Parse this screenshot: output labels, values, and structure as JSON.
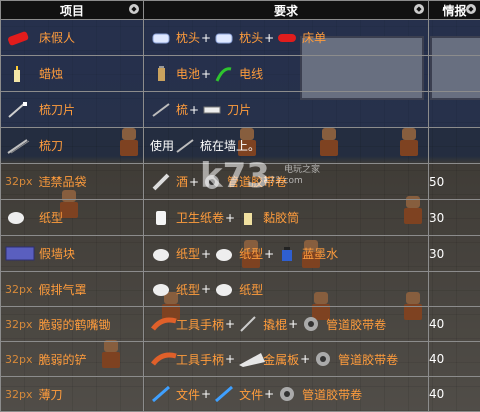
{
  "header": {
    "col_item": "项目",
    "col_req": "要求",
    "col_intel": "情报"
  },
  "rows": [
    {
      "px": "",
      "name": "床假人",
      "item_icon": "dummy-red-icon",
      "reqs": [
        {
          "icon": "pillow-icon",
          "name": "枕头",
          "plus": "+"
        },
        {
          "icon": "pillow-icon",
          "name": "枕头",
          "plus": "+"
        },
        {
          "icon": "bed-sheet-icon",
          "name": "床单",
          "plus": ""
        }
      ],
      "intel": ""
    },
    {
      "px": "",
      "name": "蜡烛",
      "item_icon": "candle-icon",
      "reqs": [
        {
          "icon": "battery-icon",
          "name": "电池",
          "plus": "+"
        },
        {
          "icon": "wire-icon",
          "name": "电线",
          "plus": ""
        }
      ],
      "intel": ""
    },
    {
      "px": "",
      "name": "梳刀片",
      "item_icon": "comb-blade-icon",
      "reqs": [
        {
          "icon": "comb-icon",
          "name": "梳",
          "plus": "+"
        },
        {
          "icon": "razor-blade-icon",
          "name": "刀片",
          "plus": ""
        }
      ],
      "intel": ""
    },
    {
      "px": "",
      "name": "梳刀",
      "item_icon": "comb-knife-icon",
      "reqs_prefix": "使用",
      "reqs": [
        {
          "icon": "comb-icon",
          "name": "梳在墙上。",
          "plus": "",
          "plain": true
        }
      ],
      "intel": ""
    },
    {
      "px": "32px",
      "name": "违禁品袋",
      "item_icon": "",
      "reqs": [
        {
          "icon": "sheet-roll-icon",
          "name": "酒",
          "plus": "+"
        },
        {
          "icon": "duct-tape-icon",
          "name": "管道胶带卷",
          "plus": ""
        }
      ],
      "intel": "50"
    },
    {
      "px": "",
      "name": "纸型",
      "item_icon": "paper-mache-icon",
      "reqs": [
        {
          "icon": "toilet-paper-icon",
          "name": "卫生纸卷",
          "plus": "+"
        },
        {
          "icon": "glue-icon",
          "name": "黏胶筒",
          "plus": ""
        }
      ],
      "intel": "30"
    },
    {
      "px": "",
      "name": "假墙块",
      "item_icon": "fake-wall-block-icon",
      "reqs": [
        {
          "icon": "paper-mache-icon",
          "name": "纸型",
          "plus": "+"
        },
        {
          "icon": "paper-mache-icon",
          "name": "纸型",
          "plus": "+"
        },
        {
          "icon": "ink-bottle-icon",
          "name": "蓝墨水",
          "plus": ""
        }
      ],
      "intel": "30"
    },
    {
      "px": "32px",
      "name": "假排气罩",
      "item_icon": "",
      "reqs": [
        {
          "icon": "paper-mache-icon",
          "name": "纸型",
          "plus": "+"
        },
        {
          "icon": "paper-mache-icon",
          "name": "纸型",
          "plus": ""
        }
      ],
      "intel": ""
    },
    {
      "px": "32px",
      "name": "脆弱的鹤嘴锄",
      "item_icon": "",
      "reqs": [
        {
          "icon": "tool-handle-icon",
          "name": "工具手柄",
          "plus": "+"
        },
        {
          "icon": "crowbar-icon",
          "name": "撬棍",
          "plus": "+"
        },
        {
          "icon": "duct-tape-icon",
          "name": "管道胶带卷",
          "plus": ""
        }
      ],
      "intel": "40"
    },
    {
      "px": "32px",
      "name": "脆弱的铲",
      "item_icon": "",
      "reqs": [
        {
          "icon": "tool-handle-icon",
          "name": "工具手柄",
          "plus": "+"
        },
        {
          "icon": "metal-sheet-icon",
          "name": "金属板",
          "plus": "+"
        },
        {
          "icon": "duct-tape-icon",
          "name": "管道胶带卷",
          "plus": ""
        }
      ],
      "intel": "40"
    },
    {
      "px": "32px",
      "name": "薄刀",
      "item_icon": "",
      "reqs": [
        {
          "icon": "file-icon",
          "name": "文件",
          "plus": "+"
        },
        {
          "icon": "file-icon",
          "name": "文件",
          "plus": "+"
        },
        {
          "icon": "duct-tape-icon",
          "name": "管道胶带卷",
          "plus": ""
        }
      ],
      "intel": "40"
    }
  ],
  "watermark": {
    "logo": "k73",
    "sub": "电玩之家",
    "url": "k73.com"
  },
  "colors": {
    "item_name": "#ff9c3c",
    "px_label": "#d88a3a",
    "header_bg": "#111111"
  }
}
